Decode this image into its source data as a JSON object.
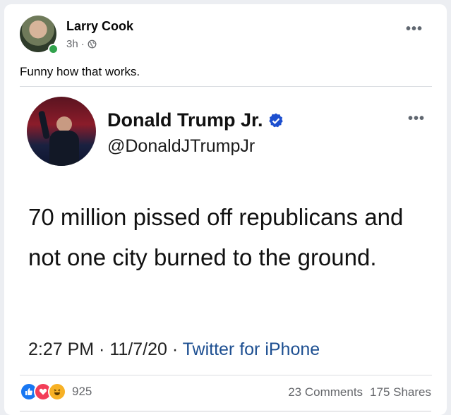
{
  "post": {
    "author": "Larry Cook",
    "time": "3h",
    "separator": "·",
    "caption": "Funny how that works.",
    "more": "•••"
  },
  "tweet": {
    "name": "Donald Trump Jr.",
    "handle": "@DonaldJTrumpJr",
    "more": "•••",
    "text": "70 million pissed off republicans and not one city burned to the ground.",
    "timestamp": "2:27 PM · 11/7/20 · ",
    "source": "Twitter for iPhone"
  },
  "engagement": {
    "reaction_count": "925",
    "comments": "23 Comments",
    "shares": "175 Shares"
  },
  "colors": {
    "accent": "#1877f2",
    "online": "#31a24c",
    "verified": "#1d9bf0"
  }
}
